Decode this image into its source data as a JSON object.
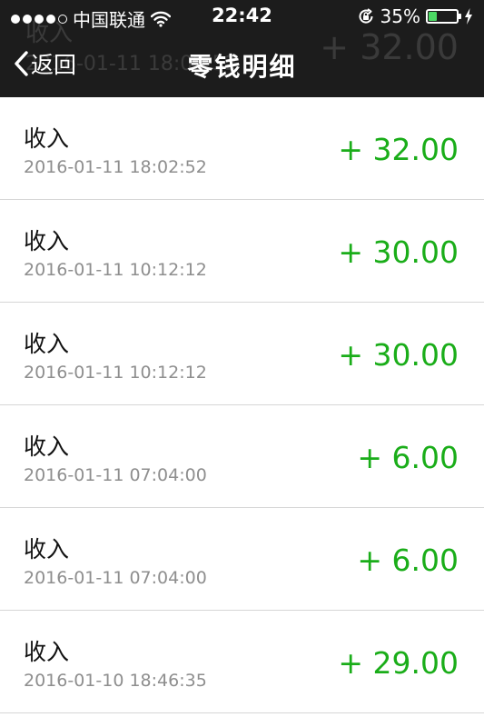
{
  "status_bar": {
    "carrier": "中国联通",
    "time": "22:42",
    "battery_percent": "35%",
    "battery_level": 0.35,
    "battery_color": "#4cd964"
  },
  "nav": {
    "back_label": "返回",
    "title": "零钱明细"
  },
  "ghost_row": {
    "type": "收入",
    "time": "2016-01-11 18:02:52",
    "amount": "+ 32.00"
  },
  "transactions": [
    {
      "type": "收入",
      "time": "2016-01-11 18:02:52",
      "amount": "+ 32.00"
    },
    {
      "type": "收入",
      "time": "2016-01-11 10:12:12",
      "amount": "+ 30.00"
    },
    {
      "type": "收入",
      "time": "2016-01-11 10:12:12",
      "amount": "+ 30.00"
    },
    {
      "type": "收入",
      "time": "2016-01-11 07:04:00",
      "amount": "+ 6.00"
    },
    {
      "type": "收入",
      "time": "2016-01-11 07:04:00",
      "amount": "+ 6.00"
    },
    {
      "type": "收入",
      "time": "2016-01-10 18:46:35",
      "amount": "+ 29.00"
    }
  ],
  "colors": {
    "header_bg": "#1c1c1c",
    "amount_green": "#1aad19",
    "time_gray": "#8e8e8e"
  },
  "icons": {
    "back": "chevron-left-icon",
    "signal": "signal-dots-icon",
    "wifi": "wifi-icon",
    "rotation_lock": "rotation-lock-icon",
    "battery": "battery-icon",
    "charging": "charging-bolt-icon"
  }
}
